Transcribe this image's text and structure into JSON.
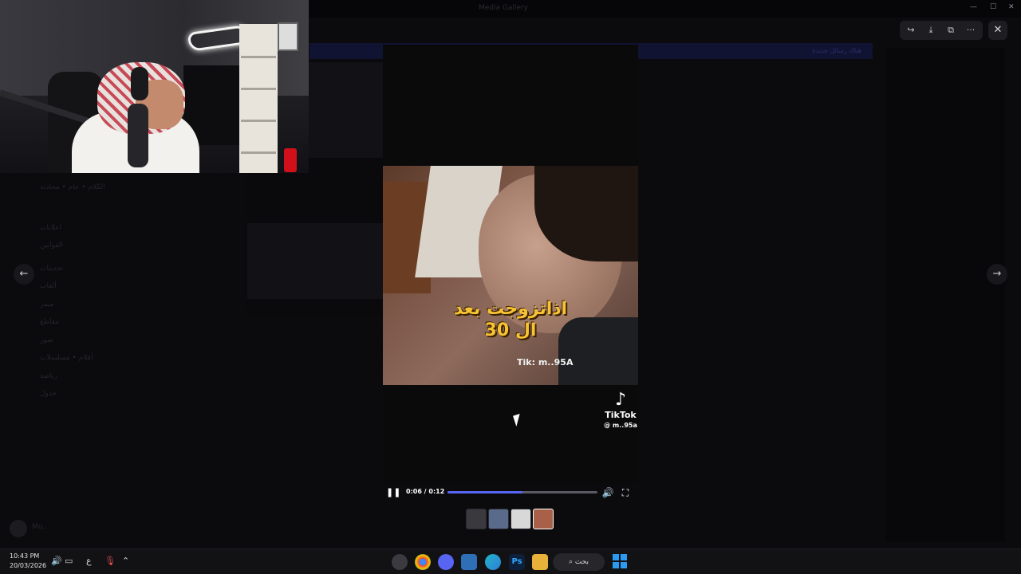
{
  "window": {
    "title": "Media Gallery",
    "minimize": "—",
    "maximize": "☐",
    "close": "✕"
  },
  "background": {
    "banner_text": "هناك رسائل جديدة",
    "channels": [
      "الكلام • عام • محادثة",
      "اعلانات",
      "القوانين",
      "تحديثات",
      "ألعاب",
      "ميمز",
      "مقاطع",
      "صور",
      "أفلام • مسلسلات",
      "رياضة",
      "جدول"
    ],
    "user_name": "Mu…"
  },
  "video": {
    "caption_line1": "اذاتزوجت بعد",
    "caption_line2": "ال 30",
    "tag": "Tik: m..95A",
    "tiktok_logo": "♪",
    "tiktok_brand": "TikTok",
    "tiktok_user": "@ m..95a",
    "time": "0:06 / 0:12",
    "progress": 0.5,
    "play_icon": "❚❚",
    "volume_icon": "🔊",
    "fullscreen_icon": "⛶"
  },
  "thumbnails": [
    {
      "name": "thumb-1",
      "color": "#3a3a3e"
    },
    {
      "name": "thumb-2",
      "color": "#5a6a8a"
    },
    {
      "name": "thumb-3",
      "color": "#d8d8d8"
    },
    {
      "name": "thumb-4",
      "color": "#a86048"
    }
  ],
  "toolbar": {
    "forward_icon": "↪",
    "download_icon": "⤓",
    "open_icon": "⧉",
    "more_icon": "···",
    "close_icon": "✕"
  },
  "nav": {
    "prev_icon": "←",
    "next_icon": "→"
  },
  "taskbar": {
    "time": "10:43 PM",
    "date": "20/03/2026",
    "lang": "ع",
    "search_label": "بحث",
    "search_icon": "⌕",
    "up_icon": "⌃",
    "mic_icon": "🎙",
    "speaker_icon": "🔊",
    "network_icon": "▭"
  },
  "colors": {
    "accent": "#5865f2",
    "caption": "#f7c233",
    "start": "#2a9bf0"
  }
}
